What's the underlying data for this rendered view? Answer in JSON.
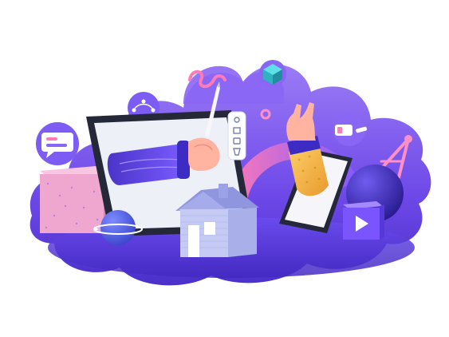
{
  "illustration": {
    "kind": "3d-creative-design-illustration",
    "palette": {
      "cloud_light": "#8a64f2",
      "cloud_mid": "#6c47e6",
      "cloud_dark": "#4a2fc7",
      "floor": "#5338d6",
      "tablet_frame": "#2a2d3e",
      "screen": "#eef0f8",
      "sleeve": "#5b3fd9",
      "skin": "#ffb8a0",
      "yellow_sleeve": "#f3b64a",
      "pink_cube": "#f3a6cf",
      "house": "#b9bff1",
      "sphere": "#3d2cc4",
      "play_block": "#7a55ff",
      "teal_cube": "#33c4cf"
    },
    "icons": [
      "chat-bubble-icon",
      "pen-tool-icon",
      "tool-panel-icon",
      "play-icon",
      "compass-icon",
      "tablet-icon",
      "smartphone-icon",
      "house-icon"
    ]
  }
}
